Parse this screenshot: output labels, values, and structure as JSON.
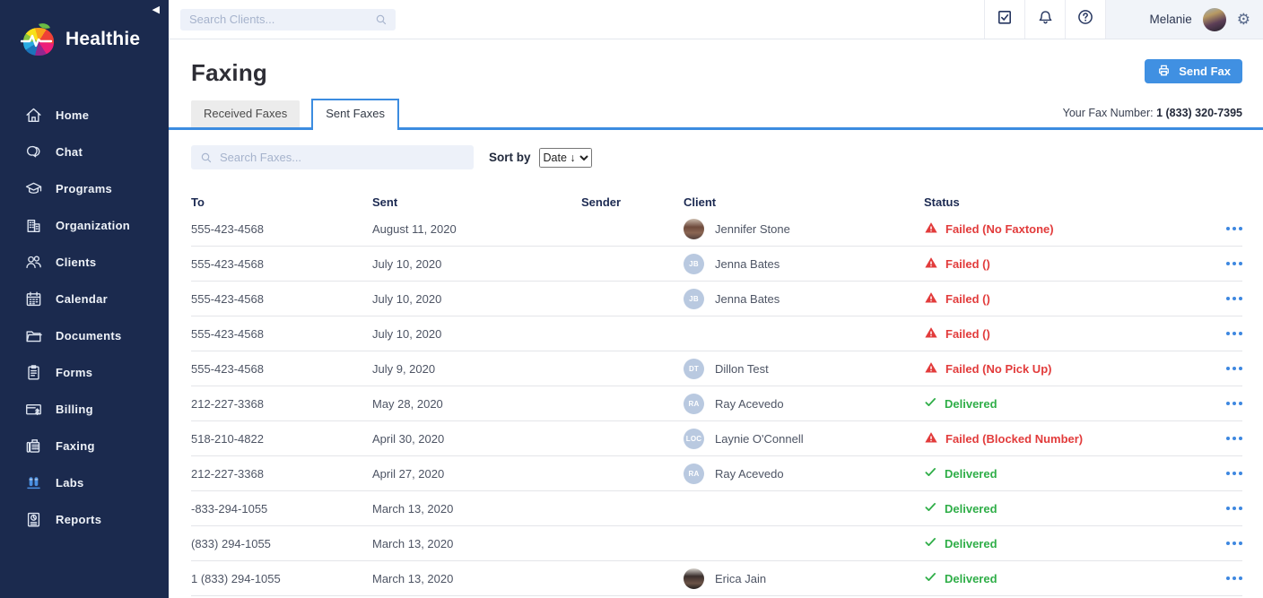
{
  "brand": {
    "name": "Healthie"
  },
  "sidebar": {
    "items": [
      {
        "label": "Home",
        "icon": "home-icon"
      },
      {
        "label": "Chat",
        "icon": "chat-icon"
      },
      {
        "label": "Programs",
        "icon": "programs-icon"
      },
      {
        "label": "Organization",
        "icon": "organization-icon"
      },
      {
        "label": "Clients",
        "icon": "clients-icon"
      },
      {
        "label": "Calendar",
        "icon": "calendar-icon"
      },
      {
        "label": "Documents",
        "icon": "documents-icon"
      },
      {
        "label": "Forms",
        "icon": "forms-icon"
      },
      {
        "label": "Billing",
        "icon": "billing-icon"
      },
      {
        "label": "Faxing",
        "icon": "faxing-icon"
      },
      {
        "label": "Labs",
        "icon": "labs-icon"
      },
      {
        "label": "Reports",
        "icon": "reports-icon"
      }
    ]
  },
  "topbar": {
    "search_placeholder": "Search Clients...",
    "user_name": "Melanie"
  },
  "page": {
    "title": "Faxing",
    "send_fax_label": "Send Fax",
    "fax_number_label": "Your Fax Number:",
    "fax_number": "1 (833) 320-7395"
  },
  "tabs": [
    {
      "label": "Received Faxes",
      "active": false
    },
    {
      "label": "Sent Faxes",
      "active": true
    }
  ],
  "toolbar": {
    "search_placeholder": "Search Faxes...",
    "sort_by_label": "Sort by",
    "sort_value": "Date ↓"
  },
  "table": {
    "headers": [
      "To",
      "Sent",
      "Sender",
      "Client",
      "Status"
    ],
    "sender_avatar": "photo-sender",
    "rows": [
      {
        "to": "555-423-4568",
        "sent": "August 11, 2020",
        "client": "Jennifer Stone",
        "avatar": "photo-jennifer",
        "initials": "",
        "status": "Failed (No Faxtone)",
        "status_type": "failed"
      },
      {
        "to": "555-423-4568",
        "sent": "July 10, 2020",
        "client": "Jenna Bates",
        "avatar": "initials",
        "initials": "JB",
        "status": "Failed ()",
        "status_type": "failed"
      },
      {
        "to": "555-423-4568",
        "sent": "July 10, 2020",
        "client": "Jenna Bates",
        "avatar": "initials",
        "initials": "JB",
        "status": "Failed ()",
        "status_type": "failed"
      },
      {
        "to": "555-423-4568",
        "sent": "July 10, 2020",
        "client": "",
        "avatar": "none",
        "initials": "",
        "status": "Failed ()",
        "status_type": "failed"
      },
      {
        "to": "555-423-4568",
        "sent": "July 9, 2020",
        "client": "Dillon Test",
        "avatar": "initials",
        "initials": "DT",
        "status": "Failed (No Pick Up)",
        "status_type": "failed"
      },
      {
        "to": "212-227-3368",
        "sent": "May 28, 2020",
        "client": "Ray Acevedo",
        "avatar": "initials",
        "initials": "RA",
        "status": "Delivered",
        "status_type": "delivered"
      },
      {
        "to": "518-210-4822",
        "sent": "April 30, 2020",
        "client": "Laynie O'Connell",
        "avatar": "initials",
        "initials": "LOC",
        "status": "Failed (Blocked Number)",
        "status_type": "failed"
      },
      {
        "to": "212-227-3368",
        "sent": "April 27, 2020",
        "client": "Ray Acevedo",
        "avatar": "initials",
        "initials": "RA",
        "status": "Delivered",
        "status_type": "delivered"
      },
      {
        "to": "-833-294-1055",
        "sent": "March 13, 2020",
        "client": "",
        "avatar": "none",
        "initials": "",
        "status": "Delivered",
        "status_type": "delivered"
      },
      {
        "to": "(833) 294-1055",
        "sent": "March 13, 2020",
        "client": "",
        "avatar": "none",
        "initials": "",
        "status": "Delivered",
        "status_type": "delivered"
      },
      {
        "to": "1 (833) 294-1055",
        "sent": "March 13, 2020",
        "client": "Erica Jain",
        "avatar": "photo-erica",
        "initials": "",
        "status": "Delivered",
        "status_type": "delivered"
      }
    ]
  },
  "colors": {
    "accent_blue": "#4090e2",
    "failed_red": "#e23b3b",
    "delivered_green": "#2fae48",
    "sidebar_navy": "#1b2a4e"
  }
}
